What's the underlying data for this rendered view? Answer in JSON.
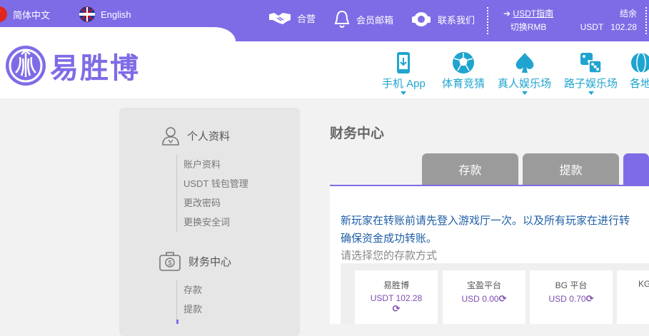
{
  "topbar": {
    "lang_cn": "简体中文",
    "lang_en": "English",
    "partner": "合营",
    "mail": "会员邮箱",
    "contact": "联系我们",
    "guide_link": "USDT指南",
    "guide_sub": "切换RMB",
    "balance_label": "结余",
    "balance_currency": "USDT",
    "balance_value": "102.28"
  },
  "header": {
    "logo_text": "易胜博",
    "nav": [
      {
        "label": "手机 App",
        "icon": "phone-app-icon"
      },
      {
        "label": "体育竞猜",
        "icon": "soccer-ball-icon"
      },
      {
        "label": "真人娱乐场",
        "icon": "spade-icon"
      },
      {
        "label": "路子娱乐场",
        "icon": "dice-icon"
      },
      {
        "label": "各地",
        "icon": "globe-icon"
      }
    ]
  },
  "sidebar": {
    "personal": {
      "title": "个人资料",
      "items": [
        "账户资料",
        "USDT 钱包管理",
        "更改密码",
        "更换安全词"
      ]
    },
    "finance": {
      "title": "财务中心",
      "items": [
        "存款",
        "提款"
      ]
    }
  },
  "main": {
    "title": "财务中心",
    "tabs": [
      "存款",
      "提款"
    ],
    "notice_line1": "新玩家在转账前请先登入游戏厅一次。以及所有玩家在进行转",
    "notice_line2": "确保资金成功转账。",
    "choose": "请选择您的存款方式",
    "platforms": [
      {
        "name": "易胜博",
        "currency": "USDT",
        "amount": "102.28"
      },
      {
        "name": "宝盈平台",
        "currency": "USD",
        "amount": "0.00"
      },
      {
        "name": "BG 平台",
        "currency": "USD",
        "amount": "0.70"
      },
      {
        "name": "KG",
        "currency": "",
        "amount": ""
      }
    ]
  },
  "colors": {
    "brand": "#7e6ce6",
    "nav": "#1fa4cf",
    "tab_grey": "#9b9b9b"
  }
}
